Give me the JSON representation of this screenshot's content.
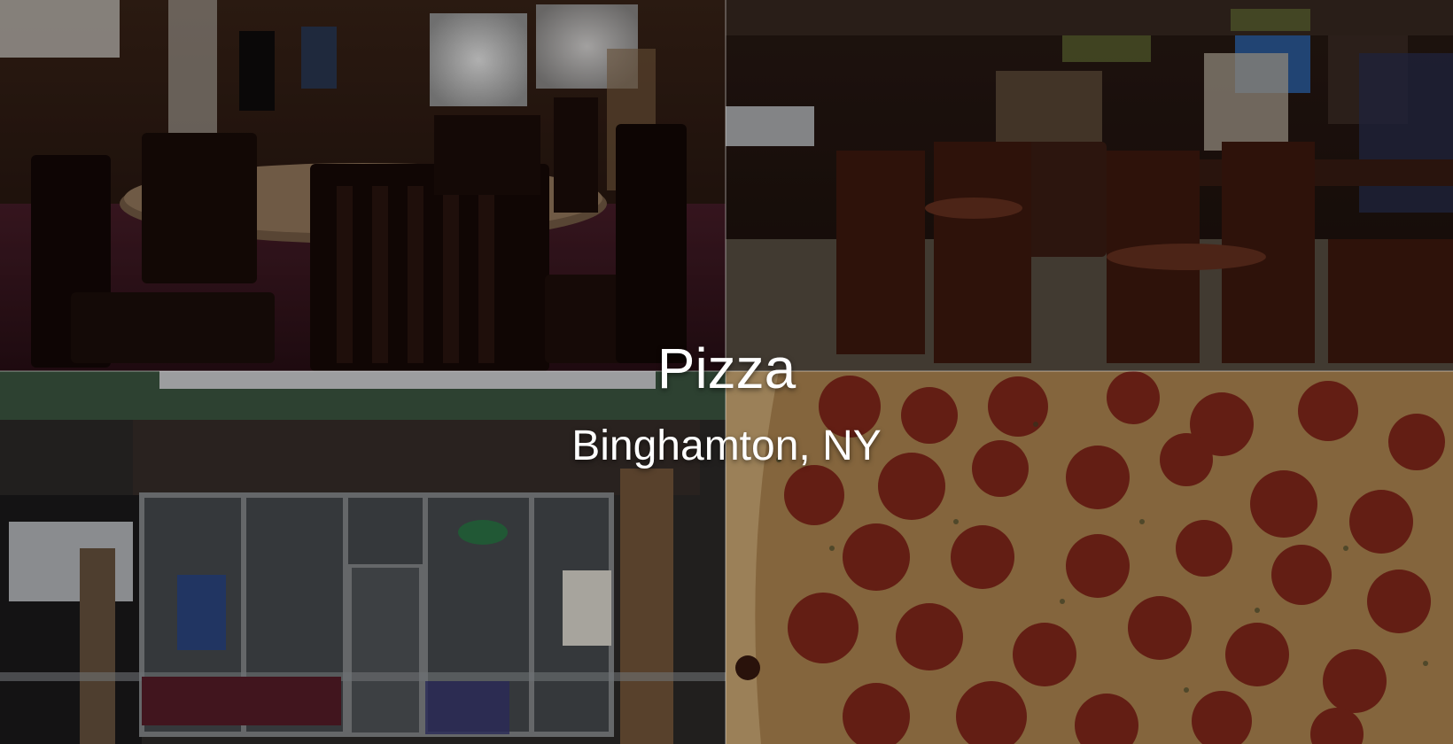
{
  "hero": {
    "title": "Pizza",
    "location": "Binghamton, NY"
  },
  "photos": [
    {
      "subject": "dining-room-tables-chairs"
    },
    {
      "subject": "bar-area-stools"
    },
    {
      "subject": "storefront-exterior"
    },
    {
      "subject": "pepperoni-pizza-closeup"
    }
  ],
  "colors": {
    "text": "#ffffff",
    "wood": "#2b1610",
    "carpet": "#3a1820",
    "pizza_crust": "#c9a56a",
    "pepperoni": "#8a2a1c"
  }
}
